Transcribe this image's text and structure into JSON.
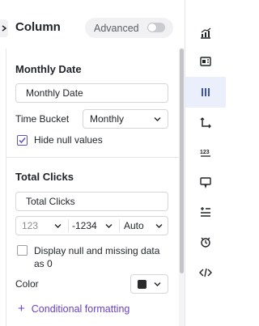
{
  "header": {
    "title": "Column",
    "advanced_label": "Advanced",
    "advanced_enabled": false
  },
  "section_date": {
    "title": "Monthly Date",
    "name_value": "Monthly Date",
    "time_bucket_label": "Time Bucket",
    "time_bucket_value": "Monthly",
    "hide_null_label": "Hide null values",
    "hide_null_checked": true
  },
  "section_clicks": {
    "title": "Total Clicks",
    "name_value": "Total Clicks",
    "number_format": "123",
    "decimals_format": "-1234",
    "scale_format": "Auto",
    "display_null_label_line1": "Display null and missing data",
    "display_null_label_line2": "as 0",
    "display_null_checked": false,
    "color_label": "Color",
    "color_value": "#2a2a2e",
    "conditional_label": "Conditional formatting",
    "conditional_plus": "+"
  },
  "rail": {
    "items": [
      {
        "icon": "chart-icon",
        "active": false
      },
      {
        "icon": "layout-icon",
        "active": false
      },
      {
        "icon": "columns-icon",
        "active": true
      },
      {
        "icon": "axes-icon",
        "active": false
      },
      {
        "icon": "number-format-icon",
        "active": false
      },
      {
        "icon": "tooltip-icon",
        "active": false
      },
      {
        "icon": "sort-list-icon",
        "active": false
      },
      {
        "icon": "alert-icon",
        "active": false
      },
      {
        "icon": "code-icon",
        "active": false
      }
    ]
  },
  "colors": {
    "accent": "#5b52c7",
    "link": "#6a40c9",
    "active_bg": "#ebeefb"
  }
}
